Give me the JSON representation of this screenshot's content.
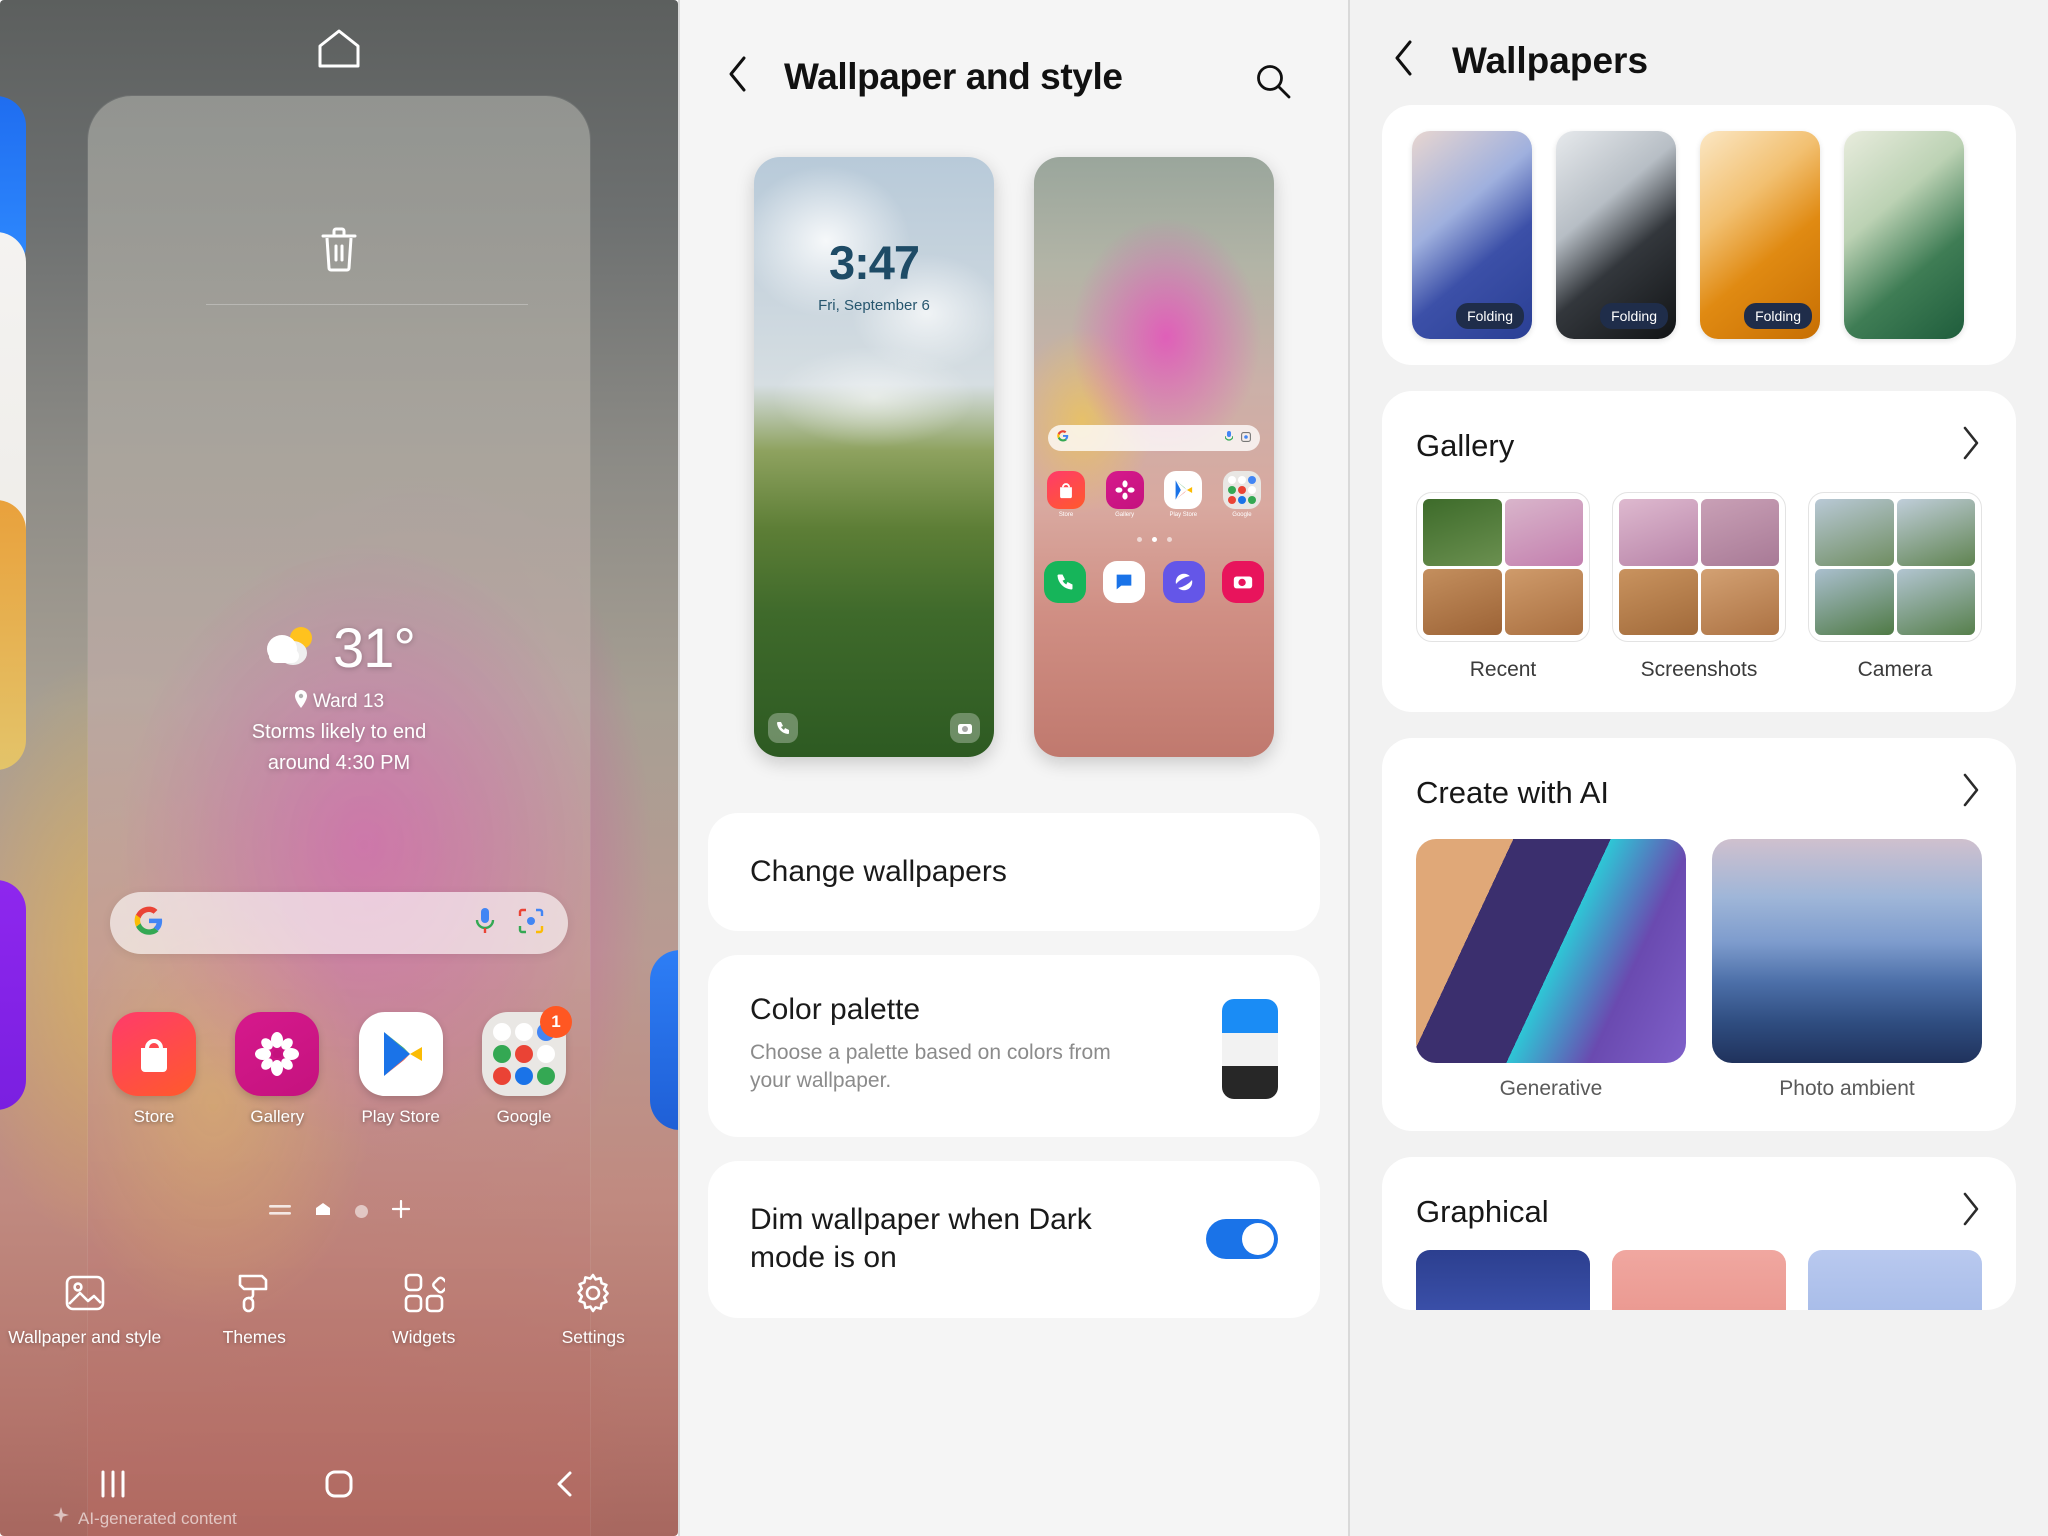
{
  "home": {
    "top_icons": {
      "home": "home-icon",
      "trash": "trash-icon"
    },
    "weather": {
      "temperature": "31°",
      "location": "Ward 13",
      "description_line1": "Storms likely to end",
      "description_line2": "around 4:30 PM"
    },
    "search_bar": {
      "logo": "google-g-icon",
      "mic": "mic-icon",
      "lens": "lens-icon"
    },
    "apps": [
      {
        "label": "Store",
        "icon": "store-bag-icon"
      },
      {
        "label": "Gallery",
        "icon": "gallery-flower-icon"
      },
      {
        "label": "Play Store",
        "icon": "play-store-icon"
      },
      {
        "label": "Google",
        "icon": "google-folder-icon",
        "badge": "1"
      }
    ],
    "toolbar": [
      {
        "label": "Wallpaper and style",
        "icon": "image-icon"
      },
      {
        "label": "Themes",
        "icon": "paint-roller-icon"
      },
      {
        "label": "Widgets",
        "icon": "widgets-grid-icon"
      },
      {
        "label": "Settings",
        "icon": "gear-icon"
      }
    ],
    "navbar": {
      "recents": "recents-icon",
      "home": "home-square-icon",
      "back": "back-chevron-icon"
    },
    "ai_note": "AI-generated content"
  },
  "wallpaper_style": {
    "back_icon": "back-chevron-icon",
    "title": "Wallpaper and style",
    "search_icon": "search-icon",
    "lock_preview": {
      "time": "3:47",
      "date": "Fri, September 6"
    },
    "home_preview": {
      "apps": [
        {
          "label": "Store"
        },
        {
          "label": "Gallery"
        },
        {
          "label": "Play Store"
        },
        {
          "label": "Google"
        }
      ]
    },
    "change_wallpapers": "Change wallpapers",
    "color_palette": {
      "title": "Color palette",
      "subtitle": "Choose a palette based on colors from your wallpaper.",
      "swatch_colors": [
        "#1a8cf5",
        "#f2f2f2",
        "#272727"
      ]
    },
    "dim_wallpaper": {
      "title": "Dim wallpaper when Dark mode is on",
      "enabled": true,
      "accent": "#1a73e8"
    }
  },
  "wallpapers": {
    "back_icon": "back-chevron-icon",
    "title": "Wallpapers",
    "folding": [
      {
        "badge": "Folding",
        "colors": [
          "#8fa4d8",
          "#2a3f94"
        ]
      },
      {
        "badge": "Folding",
        "colors": [
          "#d2d7db",
          "#1d1f22"
        ]
      },
      {
        "badge": "Folding",
        "colors": [
          "#f6d8a8",
          "#d57c0a"
        ]
      },
      {
        "badge": "",
        "colors": [
          "#d6e0c8",
          "#2f6b4e"
        ]
      }
    ],
    "gallery": {
      "title": "Gallery",
      "chevron": "chevron-right-icon",
      "items": [
        {
          "label": "Recent"
        },
        {
          "label": "Screenshots"
        },
        {
          "label": "Camera"
        }
      ]
    },
    "create_with_ai": {
      "title": "Create with AI",
      "chevron": "chevron-right-icon",
      "items": [
        {
          "label": "Generative"
        },
        {
          "label": "Photo ambient"
        }
      ]
    },
    "graphical": {
      "title": "Graphical",
      "chevron": "chevron-right-icon"
    }
  }
}
